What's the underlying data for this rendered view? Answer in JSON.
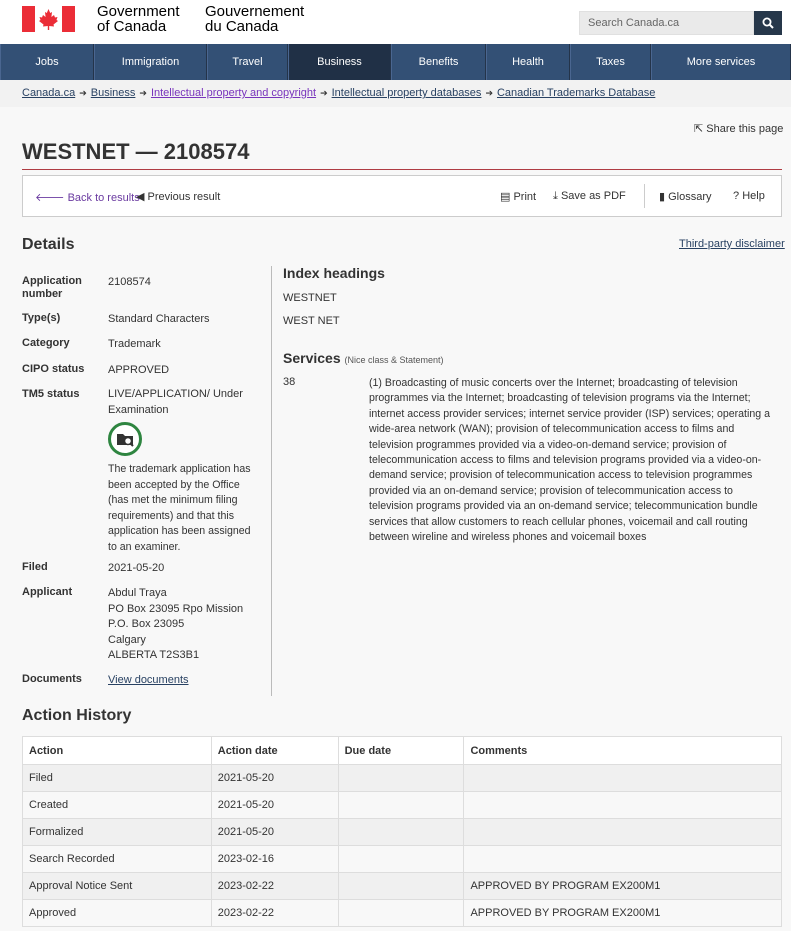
{
  "header": {
    "sig_en_1": "Government",
    "sig_en_2": "of Canada",
    "sig_fr_1": "Gouvernement",
    "sig_fr_2": "du Canada",
    "search_placeholder": "Search Canada.ca"
  },
  "menu": [
    {
      "label": "Jobs"
    },
    {
      "label": "Immigration"
    },
    {
      "label": "Travel"
    },
    {
      "label": "Business"
    },
    {
      "label": "Benefits"
    },
    {
      "label": "Health"
    },
    {
      "label": "Taxes"
    },
    {
      "label": "More services"
    }
  ],
  "breadcrumb": [
    "Canada.ca",
    "Business",
    "Intellectual property and copyright",
    "Intellectual property databases",
    "Canadian Trademarks Database"
  ],
  "share": "Share this page",
  "title": "WESTNET — 2108574",
  "toolbar": {
    "back": "Back to results",
    "previous": "Previous result",
    "print": "Print",
    "pdf": "Save as PDF",
    "glossary": "Glossary",
    "help": "Help"
  },
  "details": {
    "heading": "Details",
    "disclaimer": "Third-party disclaimer",
    "app_number_label": "Application number",
    "app_number": "2108574",
    "types_label": "Type(s)",
    "types": "Standard Characters",
    "category_label": "Category",
    "category": "Trademark",
    "cipo_label": "CIPO status",
    "cipo": "APPROVED",
    "tm5_label": "TM5 status",
    "tm5": "LIVE/APPLICATION/ Under Examination",
    "tm5_desc": "The trademark application has been accepted by the Office (has met the minimum filing requirements) and that this application has been assigned to an examiner.",
    "filed_label": "Filed",
    "filed": "2021-05-20",
    "applicant_label": "Applicant",
    "applicant": [
      "Abdul Traya",
      "PO Box 23095 Rpo Mission",
      "P.O. Box 23095",
      "Calgary",
      "ALBERTA T2S3B1"
    ],
    "documents_label": "Documents",
    "documents": "View documents"
  },
  "index": {
    "heading": "Index headings",
    "items": [
      "WESTNET",
      "WEST NET"
    ]
  },
  "services": {
    "heading": "Services",
    "sub": "(Nice class & Statement)",
    "class": "38",
    "text": "(1) Broadcasting of music concerts over the Internet; broadcasting of television programmes via the Internet; broadcasting of television programs via the Internet; internet access provider services; internet service provider (ISP) services; operating a wide-area network (WAN); provision of telecommunication access to films and television programmes provided via a video-on-demand service; provision of telecommunication access to films and television programs provided via a video-on-demand service; provision of telecommunication access to television programmes provided via an on-demand service; provision of telecommunication access to television programs provided via an on-demand service; telecommunication bundle services that allow customers to reach cellular phones, voicemail and call routing between wireline and wireless phones and voicemail boxes"
  },
  "history": {
    "heading": "Action History",
    "columns": [
      "Action",
      "Action date",
      "Due date",
      "Comments"
    ],
    "rows": [
      [
        "Filed",
        "2021-05-20",
        "",
        ""
      ],
      [
        "Created",
        "2021-05-20",
        "",
        ""
      ],
      [
        "Formalized",
        "2021-05-20",
        "",
        ""
      ],
      [
        "Search Recorded",
        "2023-02-16",
        "",
        ""
      ],
      [
        "Approval Notice Sent",
        "2023-02-22",
        "",
        "APPROVED BY PROGRAM EX200M1"
      ],
      [
        "Approved",
        "2023-02-22",
        "",
        "APPROVED BY PROGRAM EX200M1"
      ]
    ]
  }
}
